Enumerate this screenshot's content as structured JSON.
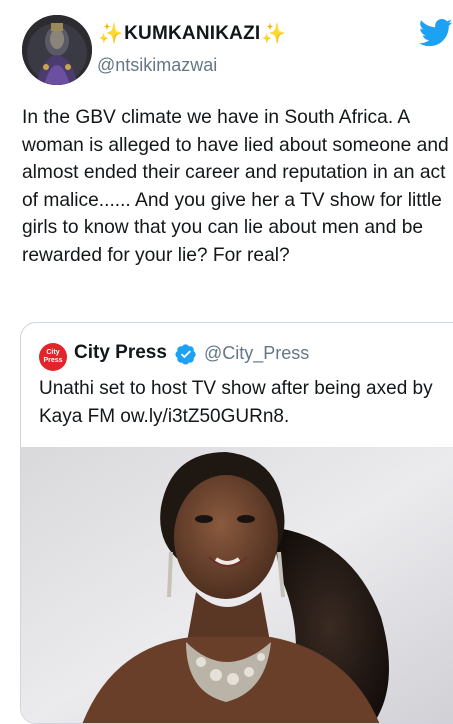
{
  "tweet": {
    "display_name": "KUMKANIKAZI",
    "handle": "@ntsikimazwai",
    "text": "In the GBV climate we have in South Africa. A woman is alleged to have lied about someone and almost ended their career and reputation in an act of malice...... And you give her a TV show for little girls to know that you can lie about men and be rewarded for your lie? For real?",
    "sparkle_glyph": "✨",
    "colors": {
      "twitter_blue": "#1da1f2",
      "handle_gray": "#657786",
      "sparkle": "#f5b400"
    }
  },
  "quoted_tweet": {
    "logo_text_line1": "City",
    "logo_text_line2": "Press",
    "name": "City Press",
    "handle": "@City_Press",
    "text": "Unathi set to host TV show after being axed by Kaya FM ow.ly/i3tZ50GURn8.",
    "verified": true,
    "colors": {
      "logo_red": "#e0262b",
      "verified_blue": "#1da1f2"
    }
  },
  "icons": {
    "platform": "twitter-bird-icon",
    "verified": "verified-badge-icon"
  }
}
